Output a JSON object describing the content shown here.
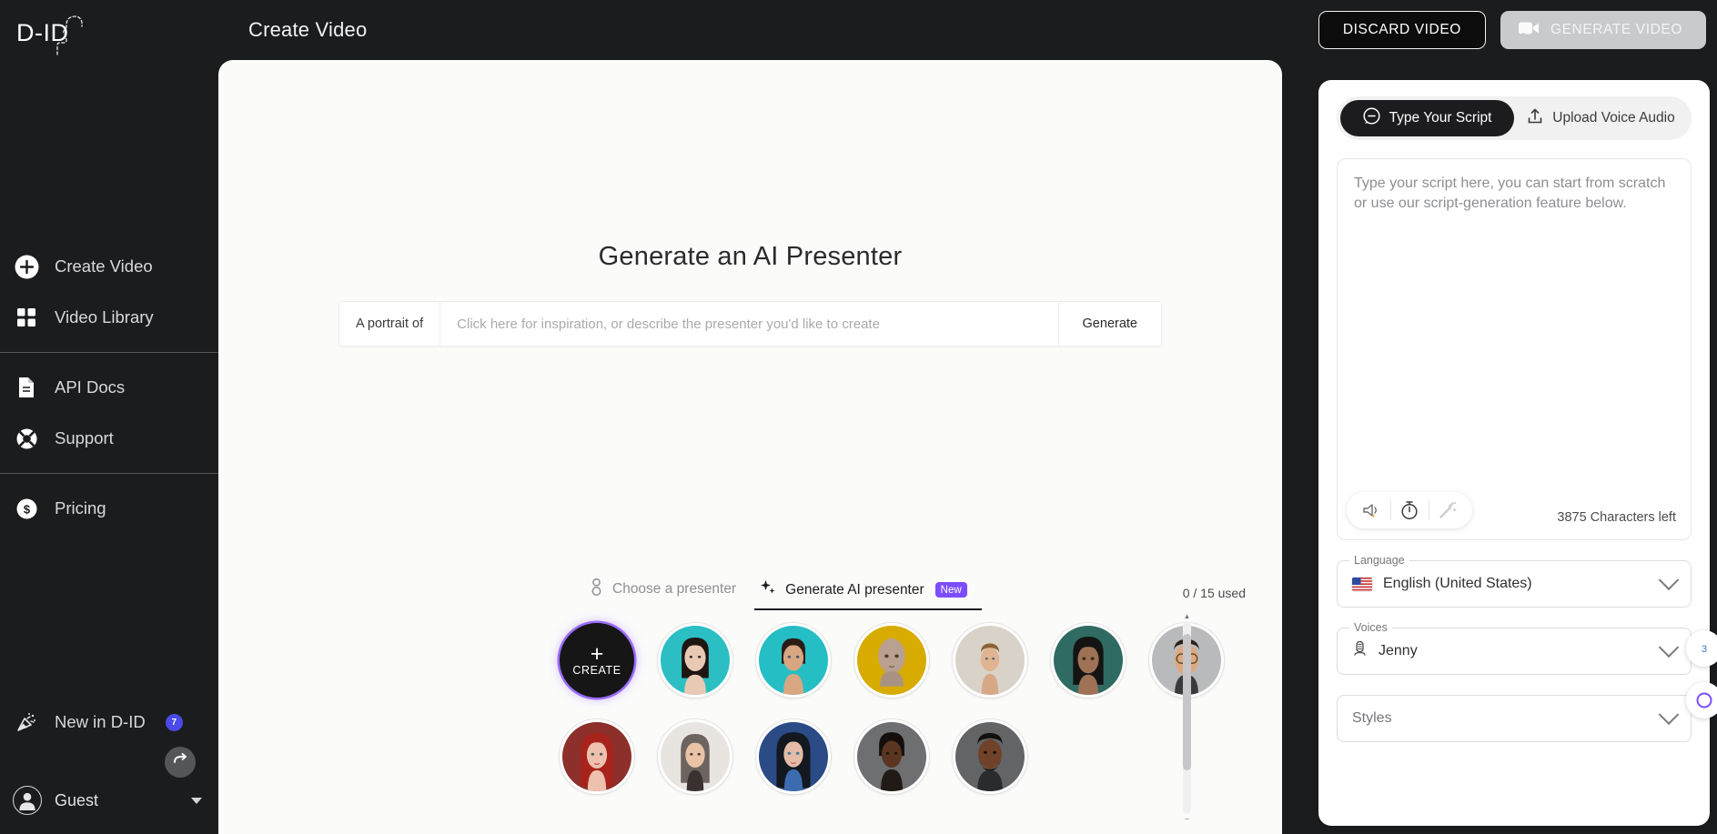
{
  "brand": {
    "logo_text": "D-ID",
    "logo_icon": "face-profile-icon"
  },
  "sidebar": {
    "primary_items": [
      {
        "label": "Create Video",
        "icon": "plus-circle-icon"
      },
      {
        "label": "Video Library",
        "icon": "grid-squares-icon"
      }
    ],
    "secondary_items": [
      {
        "label": "API Docs",
        "icon": "document-icon"
      },
      {
        "label": "Support",
        "icon": "lifebuoy-icon"
      }
    ],
    "tertiary_items": [
      {
        "label": "Pricing",
        "icon": "dollar-circle-icon"
      }
    ],
    "new_in": {
      "label": "New in D-ID",
      "icon": "party-popper-icon",
      "badge": "7"
    },
    "collapse": {
      "icon": "collapse-arrow-icon"
    },
    "user": {
      "name": "Guest",
      "icon": "person-avatar-icon",
      "caret": "caret-down-icon"
    }
  },
  "header": {
    "title": "Create Video",
    "discard_label": "DISCARD VIDEO",
    "generate_label": "GENERATE VIDEO",
    "generate_icon": "video-camera-icon"
  },
  "main": {
    "hero_title": "Generate an AI Presenter",
    "prompt_prefix": "A portrait of",
    "prompt_placeholder": "Click here for inspiration, or describe the presenter you'd like to create",
    "prompt_value": "",
    "generate_label": "Generate"
  },
  "picker": {
    "tabs": [
      {
        "label": "Choose a presenter",
        "icon": "person-icon",
        "active": false
      },
      {
        "label": "Generate AI presenter",
        "icon": "sparkle-icon",
        "active": true,
        "badge": "New"
      }
    ],
    "used_count": "0 / 15 used",
    "create": {
      "plus": "+",
      "label": "CREATE"
    },
    "avatars": [
      {
        "name": "presenter-1",
        "bg": "#2bbfc3",
        "skin": "#e6c3ad",
        "hair": "#1f1612",
        "style": "long-dark-hair-woman"
      },
      {
        "name": "presenter-2",
        "bg": "#25bec4",
        "skin": "#d8a681",
        "hair": "#2a1c14",
        "style": "short-hair-woman"
      },
      {
        "name": "presenter-3",
        "bg": "#d8ab00",
        "skin": "#b9a08f",
        "hair": "#b9a08f",
        "style": "bald-figure"
      },
      {
        "name": "presenter-4",
        "bg": "#d9d2c8",
        "skin": "#e0b492",
        "hair": "#8a6236",
        "style": "illustrated-man"
      },
      {
        "name": "presenter-5",
        "bg": "#2f6b63",
        "skin": "#9f7256",
        "hair": "#141414",
        "style": "dark-teal-woman"
      },
      {
        "name": "presenter-6",
        "bg": "#b9babb",
        "skin": "#dfa87e",
        "hair": "#2b2118",
        "style": "man-with-glasses"
      },
      {
        "name": "presenter-7",
        "bg": "#8d2f2a",
        "skin": "#eec0ae",
        "hair": "#a8231c",
        "style": "red-hair-woman"
      },
      {
        "name": "presenter-8",
        "bg": "#e8e4df",
        "skin": "#e8c3a6",
        "hair": "#6d6460",
        "style": "gray-hair-woman"
      },
      {
        "name": "presenter-9",
        "bg": "#2b4b86",
        "skin": "#e4bca8",
        "hair": "#14181f",
        "style": "blue-theme-woman"
      },
      {
        "name": "presenter-10",
        "bg": "#6e6f71",
        "skin": "#5a3520",
        "hair": "#140f0c",
        "style": "dark-skin-woman"
      },
      {
        "name": "presenter-11",
        "bg": "#636466",
        "skin": "#70422a",
        "hair": "#13100d",
        "style": "dark-skin-man"
      }
    ]
  },
  "right_panel": {
    "tabs": [
      {
        "label": "Type Your Script",
        "icon": "chat-bubble-icon",
        "active": true
      },
      {
        "label": "Upload Voice Audio",
        "icon": "upload-icon",
        "active": false
      }
    ],
    "script_placeholder": "Type your script here, you can start from scratch or use our script-generation feature below.",
    "script_value": "",
    "tools": [
      {
        "name": "speaker-icon",
        "disabled": false
      },
      {
        "name": "timer-icon",
        "disabled": false
      },
      {
        "name": "magic-wand-icon",
        "disabled": true
      }
    ],
    "characters_left": "3875 Characters left",
    "language": {
      "label": "Language",
      "value": "English (United States)",
      "flag": "us-flag-icon"
    },
    "voices": {
      "label": "Voices",
      "value": "Jenny",
      "icon": "voice-icon"
    },
    "styles": {
      "label": "",
      "placeholder": "Styles"
    }
  },
  "colors": {
    "sidebar_bg": "#1b1c1e",
    "canvas_bg": "#fbfbfa",
    "accent_purple": "#7c4dff",
    "badge_blue": "#4a4ae8"
  }
}
